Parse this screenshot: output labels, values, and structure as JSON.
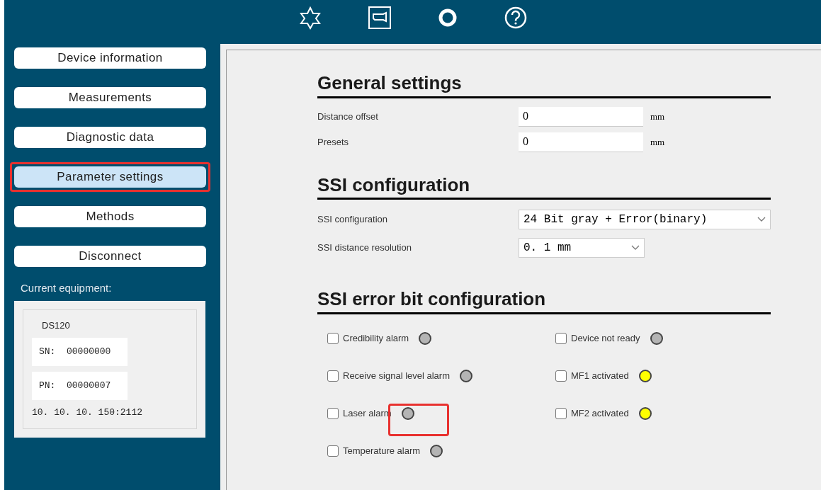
{
  "toolbar": {
    "icons": [
      {
        "kind": "star"
      },
      {
        "kind": "camera"
      },
      {
        "kind": "ring"
      },
      {
        "kind": "help"
      }
    ]
  },
  "sidebar": {
    "items": [
      {
        "label": "Device information",
        "selected": false,
        "highlighted": false
      },
      {
        "label": "Measurements",
        "selected": false,
        "highlighted": false
      },
      {
        "label": "Diagnostic data",
        "selected": false,
        "highlighted": false
      },
      {
        "label": "Parameter settings",
        "selected": true,
        "highlighted": true
      },
      {
        "label": "Methods",
        "selected": false,
        "highlighted": false
      },
      {
        "label": "Disconnect",
        "selected": false,
        "highlighted": false
      }
    ],
    "equipment_label": "Current equipment:",
    "equipment": {
      "model": "DS120",
      "sn": "SN:  00000000",
      "pn": "PN:  00000007",
      "address": "10. 10. 10. 150:2112"
    }
  },
  "general": {
    "title": "General settings",
    "fields": [
      {
        "label": "Distance offset",
        "value": "0",
        "unit": "mm"
      },
      {
        "label": "Presets",
        "value": "0",
        "unit": "mm"
      }
    ]
  },
  "ssi": {
    "title": "SSI configuration",
    "selects": [
      {
        "label": "SSI configuration",
        "value": "24 Bit gray + Error(binary)",
        "wide": true
      },
      {
        "label": "SSI distance resolution",
        "value": "0. 1 mm",
        "wide": false
      }
    ]
  },
  "error_bits": {
    "title": "SSI error bit configuration",
    "columns": [
      [
        {
          "label": "Credibility alarm",
          "checked": false,
          "color": "#b4b4b4",
          "highlighted": false
        },
        {
          "label": "Receive signal level alarm",
          "checked": false,
          "color": "#b4b4b4",
          "highlighted": false
        },
        {
          "label": "Laser alarm",
          "checked": false,
          "color": "#b4b4b4",
          "highlighted": true
        },
        {
          "label": "Temperature alarm",
          "checked": false,
          "color": "#b4b4b4",
          "highlighted": false
        }
      ],
      [
        {
          "label": "Device not ready",
          "checked": false,
          "color": "#b4b4b4",
          "highlighted": false
        },
        {
          "label": "MF1 activated",
          "checked": false,
          "color": "#ffff00",
          "highlighted": false
        },
        {
          "label": "MF2 activated",
          "checked": false,
          "color": "#ffff00",
          "highlighted": false
        }
      ]
    ]
  }
}
